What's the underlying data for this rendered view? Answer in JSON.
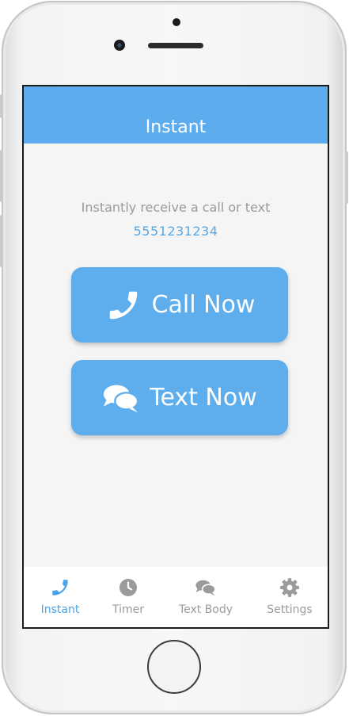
{
  "header": {
    "title": "Instant"
  },
  "main": {
    "subtitle": "Instantly receive a call or text",
    "phone_number": "5551231234",
    "call_button": {
      "label": "Call Now",
      "icon": "phone-icon"
    },
    "text_button": {
      "label": "Text Now",
      "icon": "chat-bubbles-icon"
    }
  },
  "tabs": [
    {
      "label": "Instant",
      "icon": "phone-icon",
      "active": true
    },
    {
      "label": "Timer",
      "icon": "clock-icon",
      "active": false
    },
    {
      "label": "Text Body",
      "icon": "chat-bubbles-icon",
      "active": false
    },
    {
      "label": "Settings",
      "icon": "gear-icon",
      "active": false
    }
  ],
  "colors": {
    "accent": "#5eaeee",
    "active_tab": "#4aa3e6",
    "inactive_tab": "#9b9b9b",
    "background": "#f5f5f5"
  }
}
